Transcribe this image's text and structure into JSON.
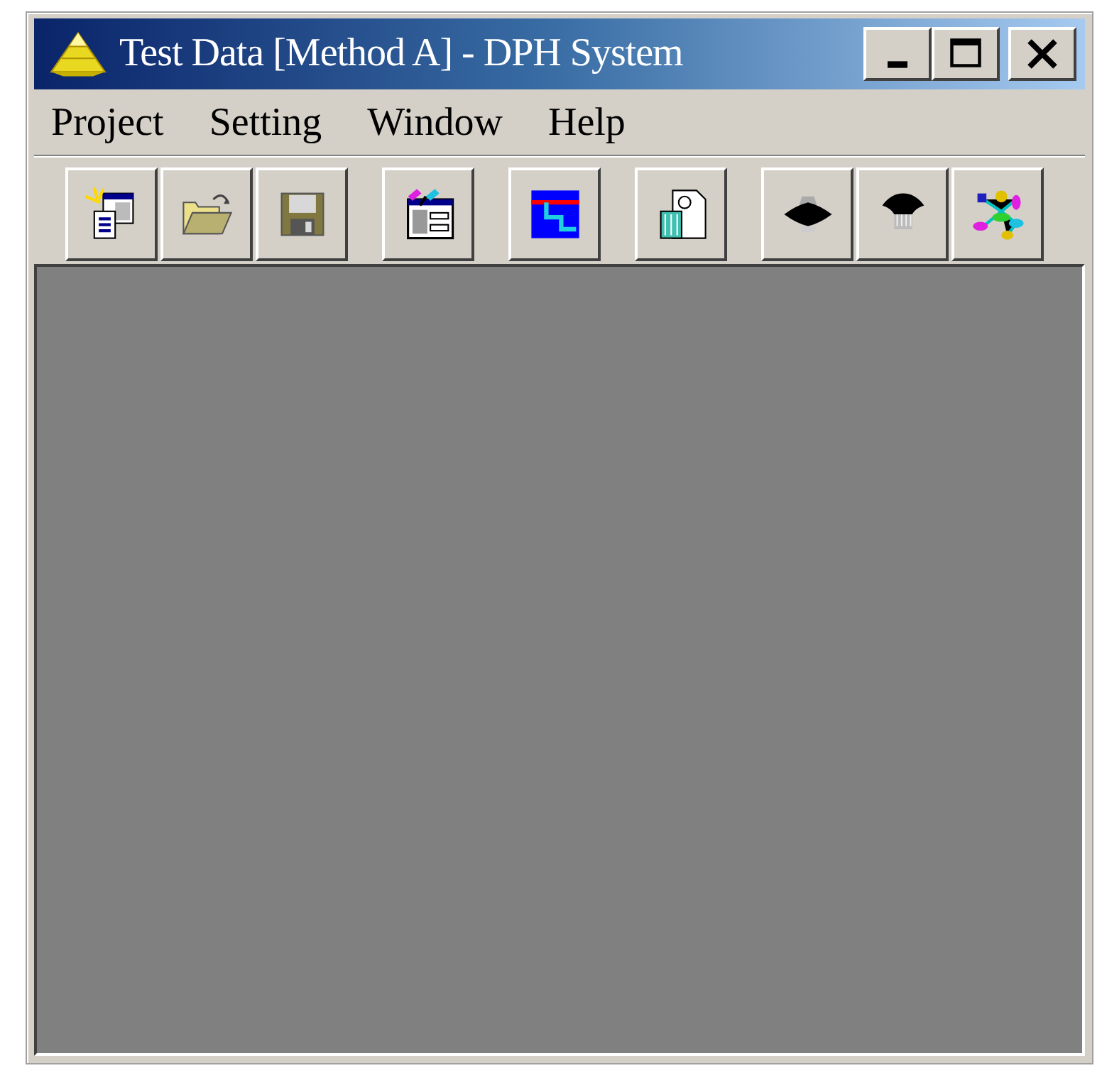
{
  "window": {
    "title": "Test Data [Method A] - DPH System"
  },
  "menu": [
    "Project",
    "Setting",
    "Window",
    "Help"
  ]
}
